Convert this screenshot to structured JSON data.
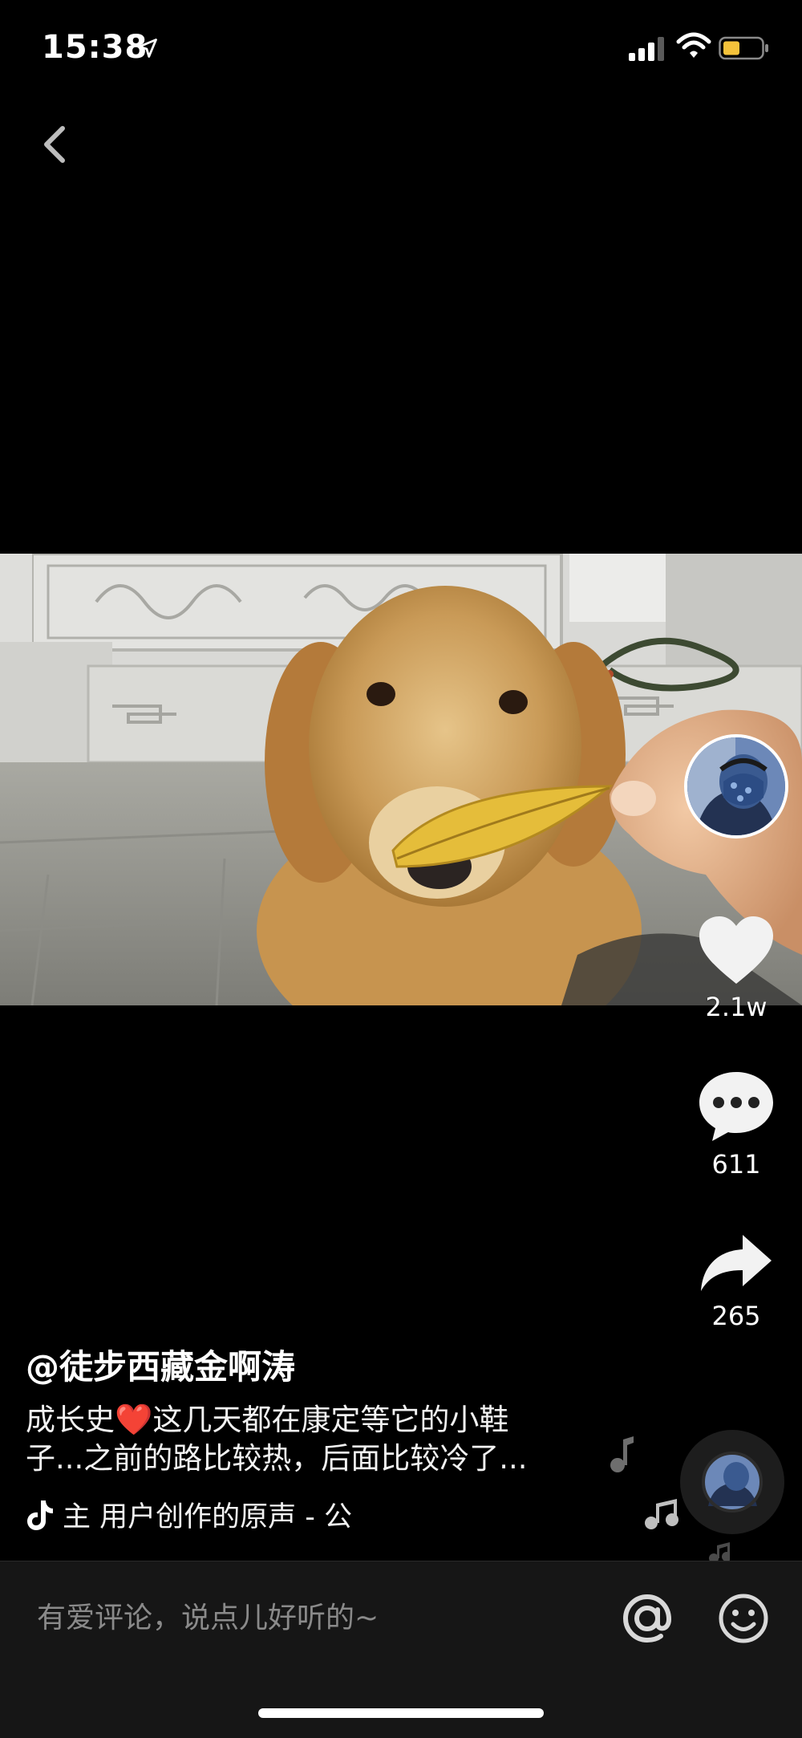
{
  "status_bar": {
    "time": "15:38",
    "icons": [
      "location-arrow-icon",
      "signal-icon",
      "wifi-icon",
      "battery-icon"
    ],
    "battery_color": "#f5c33b"
  },
  "nav": {
    "back_icon": "chevron-left-icon"
  },
  "video": {
    "description_icon": "video-frame"
  },
  "actions": {
    "like_count": "2.1w",
    "comment_count": "611",
    "share_count": "265"
  },
  "post": {
    "author": "@徒步西藏金啊涛",
    "caption_line1_before": "成长史",
    "caption_emoji": "❤️",
    "caption_line1_after": "这几天都在康定等它的小鞋",
    "caption_line2": "子...之前的路比较热，后面比较冷了...",
    "music_text": "主    用户创作的原声 - 公"
  },
  "comment_bar": {
    "placeholder": "有爱评论，说点儿好听的~",
    "at_icon": "at-icon",
    "emoji_icon": "smiley-icon"
  },
  "colors": {
    "background": "#000000",
    "comment_bar": "#161616",
    "heart_emoji": "#e8202a"
  }
}
